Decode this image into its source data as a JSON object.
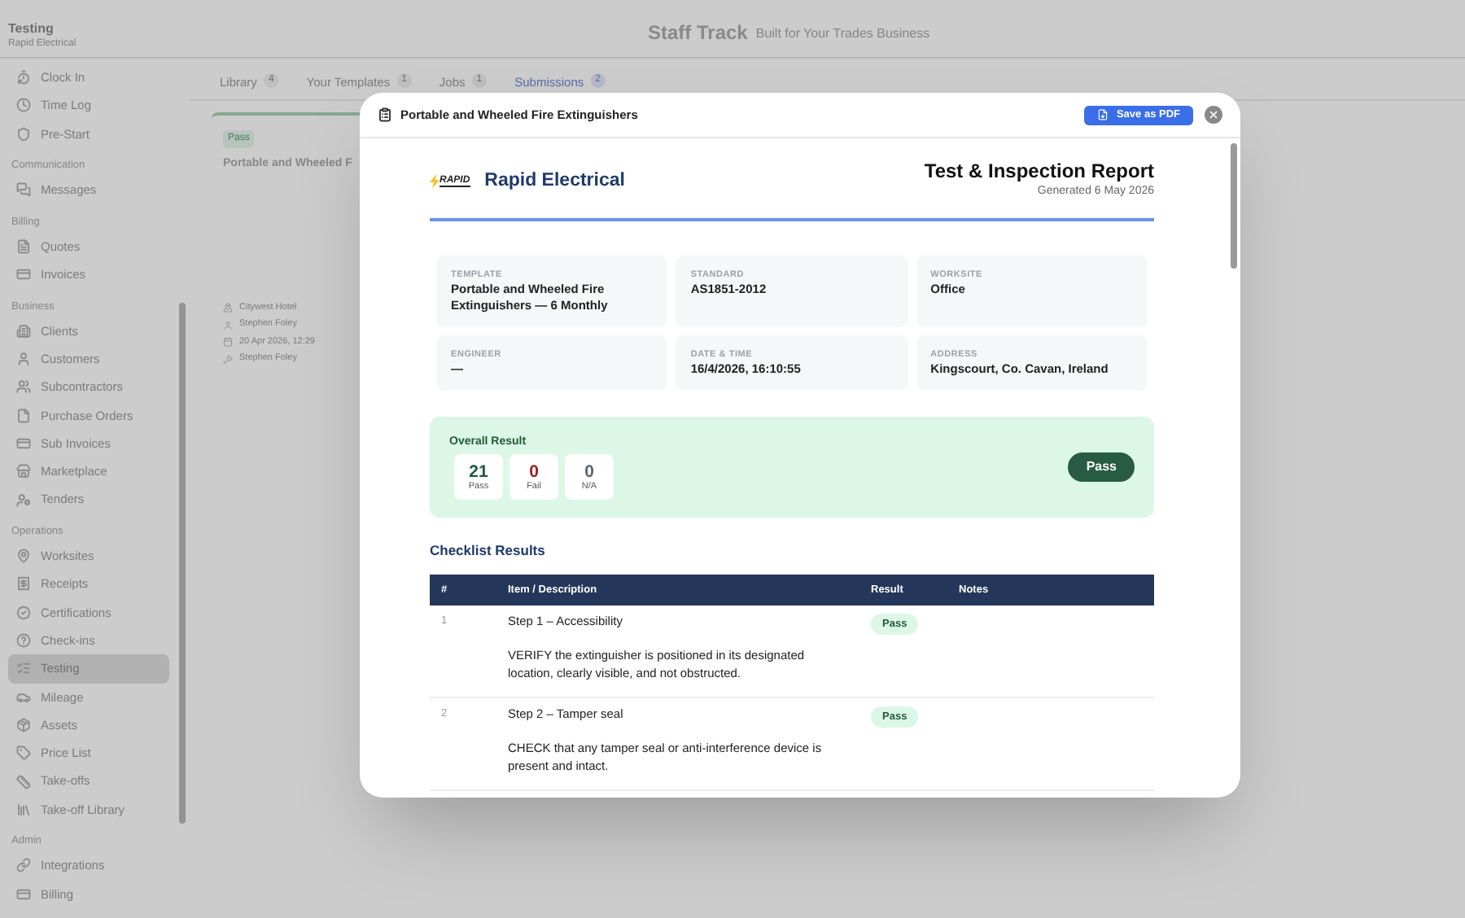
{
  "sidebar": {
    "title": "Testing",
    "subtitle": "Rapid Electrical",
    "sections": [
      {
        "items": [
          {
            "label": "Clock In",
            "selected": false
          },
          {
            "label": "Time Log",
            "selected": false
          },
          {
            "label": "Pre-Start",
            "selected": false
          }
        ]
      },
      {
        "title": "Communication",
        "items": [
          {
            "label": "Messages",
            "selected": false
          }
        ]
      },
      {
        "title": "Billing",
        "items": [
          {
            "label": "Quotes",
            "selected": false
          },
          {
            "label": "Invoices",
            "selected": false
          }
        ]
      },
      {
        "title": "Business",
        "items": [
          {
            "label": "Clients",
            "selected": false
          },
          {
            "label": "Customers",
            "selected": false
          },
          {
            "label": "Subcontractors",
            "selected": false
          },
          {
            "label": "Purchase Orders",
            "selected": false
          },
          {
            "label": "Sub Invoices",
            "selected": false
          },
          {
            "label": "Marketplace",
            "selected": false
          },
          {
            "label": "Tenders",
            "selected": false
          }
        ]
      },
      {
        "title": "Operations",
        "items": [
          {
            "label": "Worksites",
            "selected": false
          },
          {
            "label": "Receipts",
            "selected": false
          },
          {
            "label": "Certifications",
            "selected": false
          },
          {
            "label": "Check-ins",
            "selected": false
          },
          {
            "label": "Testing",
            "selected": true
          },
          {
            "label": "Mileage",
            "selected": false
          },
          {
            "label": "Assets",
            "selected": false
          },
          {
            "label": "Price List",
            "selected": false
          },
          {
            "label": "Take-offs",
            "selected": false
          },
          {
            "label": "Take-off Library",
            "selected": false
          }
        ]
      },
      {
        "title": "Admin",
        "items": [
          {
            "label": "Integrations",
            "selected": false
          },
          {
            "label": "Billing",
            "selected": false
          }
        ]
      }
    ]
  },
  "header": {
    "brand": "Staff Track",
    "tagline": "Built for Your Trades Business"
  },
  "tabs": [
    {
      "label": "Library",
      "count": "4",
      "selected": false
    },
    {
      "label": "Your Templates",
      "count": "1",
      "selected": false
    },
    {
      "label": "Jobs",
      "count": "1",
      "selected": false
    },
    {
      "label": "Submissions",
      "count": "2",
      "selected": true
    }
  ],
  "submission_card": {
    "status": "Pass",
    "title": "Portable and Wheeled F",
    "worksite": "Citywest Hotel",
    "submitted_by": "Stephen Foley",
    "date": "20 Apr 2026, 12:29",
    "engineer": "Stephen Foley"
  },
  "modal": {
    "title": "Portable and Wheeled Fire Extinguishers",
    "save_button": "Save as PDF",
    "report": {
      "logo_text": "RAPID",
      "company": "Rapid Electrical",
      "heading": "Test & Inspection Report",
      "generated": "Generated 6 May 2026",
      "fields": [
        {
          "label": "TEMPLATE",
          "value": "Portable and Wheeled Fire Extinguishers — 6 Monthly"
        },
        {
          "label": "STANDARD",
          "value": "AS1851-2012"
        },
        {
          "label": "WORKSITE",
          "value": "Office"
        },
        {
          "label": "ENGINEER",
          "value": "—"
        },
        {
          "label": "DATE & TIME",
          "value": "16/4/2026, 16:10:55"
        },
        {
          "label": "ADDRESS",
          "value": "Kingscourt, Co. Cavan, Ireland"
        }
      ],
      "overall": {
        "title": "Overall Result",
        "result": "Pass",
        "stats": [
          {
            "value": "21",
            "label": "Pass",
            "color": "#1e5c3a"
          },
          {
            "value": "0",
            "label": "Fail",
            "color": "#9b1c1c"
          },
          {
            "value": "0",
            "label": "N/A",
            "color": "#5a6478"
          }
        ]
      },
      "checklist": {
        "title": "Checklist Results",
        "columns": [
          "#",
          "Item / Description",
          "Result",
          "Notes"
        ],
        "rows": [
          {
            "number": "1",
            "step": "Step 1 – Accessibility",
            "description": "VERIFY the extinguisher is positioned in its designated location, clearly visible, and not obstructed.",
            "result": "Pass"
          },
          {
            "number": "2",
            "step": "Step 2 – Tamper seal",
            "description": "CHECK that any tamper seal or anti-interference device is present and intact.",
            "result": "Pass"
          }
        ]
      }
    }
  }
}
